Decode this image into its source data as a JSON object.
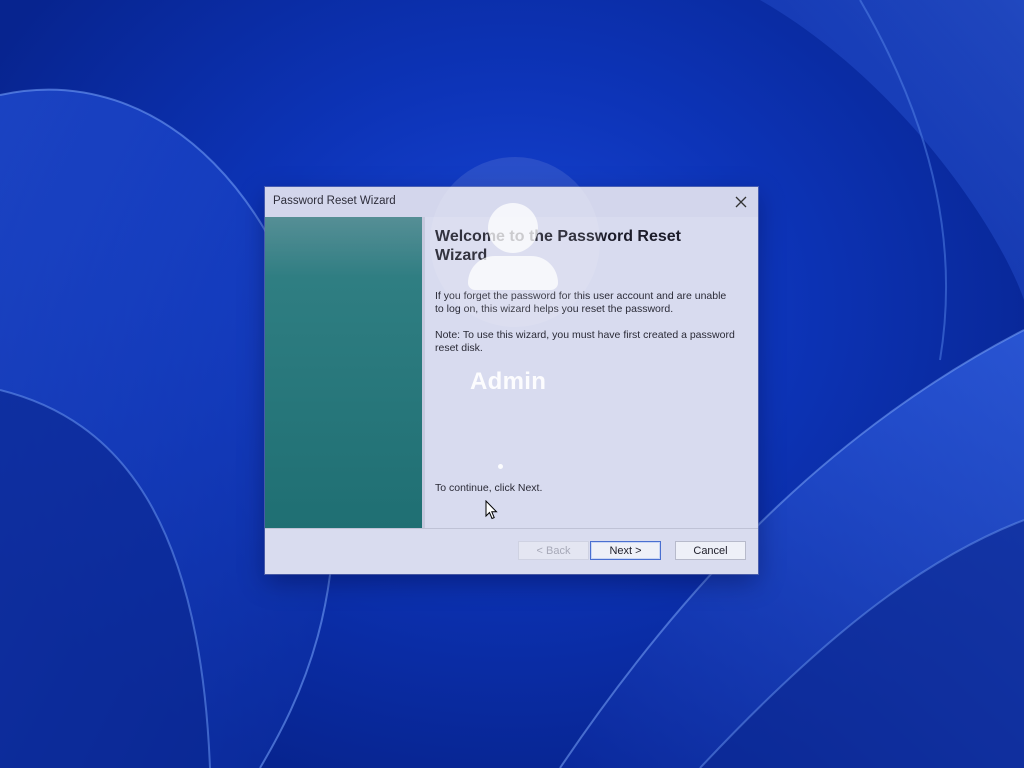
{
  "desktop": {
    "accent": "#0d34b8"
  },
  "dialog": {
    "title": "Password Reset Wizard",
    "close_icon": "close-icon",
    "heading": "Welcome to the Password Reset Wizard",
    "paragraph1": "If you forget the password for this user account and are unable to log on, this wizard helps you reset the password.",
    "paragraph2": "Note: To use this wizard, you must have first created a password reset disk.",
    "instruction": "To continue, click Next.",
    "sidebar_color": "#2f7e82",
    "buttons": {
      "back": "< Back",
      "next": "Next >",
      "cancel": "Cancel"
    }
  },
  "lockscreen": {
    "username": "Admin",
    "avatar_icon": "user-avatar-icon"
  }
}
